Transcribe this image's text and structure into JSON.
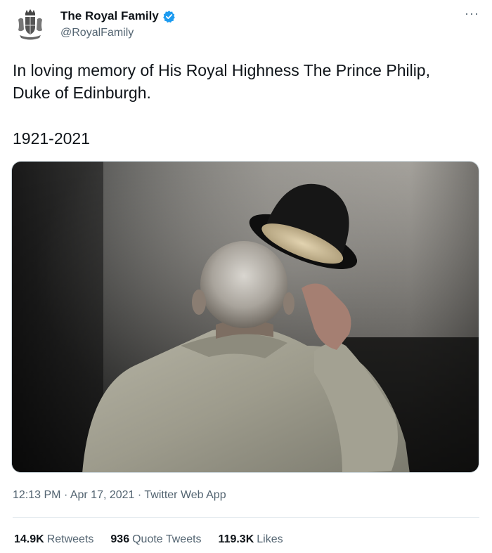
{
  "author": {
    "display_name": "The Royal Family",
    "handle": "@RoyalFamily",
    "verified": true,
    "avatar_icon": "royal-coat-of-arms-icon",
    "more_icon": "more-options-icon"
  },
  "tweet": {
    "text": "In loving memory of His Royal Highness The Prince Philip, Duke of Edinburgh.",
    "year": "1921-2021"
  },
  "media": {
    "type": "photo"
  },
  "meta": {
    "time": "12:13 PM",
    "separator": "·",
    "date": "Apr 17, 2021",
    "source": "Twitter Web App"
  },
  "stats": {
    "retweets": {
      "count": "14.9K",
      "label": "Retweets"
    },
    "quote_tweets": {
      "count": "936",
      "label": "Quote Tweets"
    },
    "likes": {
      "count": "119.3K",
      "label": "Likes"
    }
  },
  "colors": {
    "verified": "#1d9bf0",
    "text": "#0f1419",
    "secondary": "#536471",
    "border": "#e6ecf0"
  }
}
